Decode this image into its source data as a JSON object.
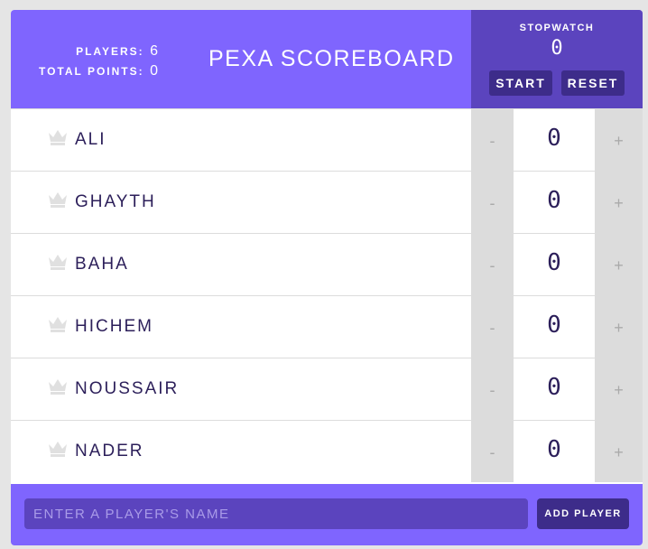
{
  "header": {
    "players_label": "PLAYERS:",
    "players_count": "6",
    "total_points_label": "TOTAL POINTS:",
    "total_points": "0",
    "title": "PEXA SCOREBOARD"
  },
  "stopwatch": {
    "label": "STOPWATCH",
    "time": "0",
    "start_label": "START",
    "reset_label": "RESET"
  },
  "players": [
    {
      "name": "ALI",
      "score": "0",
      "decrement_label": "-",
      "increment_label": "+",
      "crown_icon": "crown-icon"
    },
    {
      "name": "GHAYTH",
      "score": "0",
      "decrement_label": "-",
      "increment_label": "+",
      "crown_icon": "crown-icon"
    },
    {
      "name": "BAHA",
      "score": "0",
      "decrement_label": "-",
      "increment_label": "+",
      "crown_icon": "crown-icon"
    },
    {
      "name": "HICHEM",
      "score": "0",
      "decrement_label": "-",
      "increment_label": "+",
      "crown_icon": "crown-icon"
    },
    {
      "name": "NOUSSAIR",
      "score": "0",
      "decrement_label": "-",
      "increment_label": "+",
      "crown_icon": "crown-icon"
    },
    {
      "name": "NADER",
      "score": "0",
      "decrement_label": "-",
      "increment_label": "+",
      "crown_icon": "crown-icon"
    }
  ],
  "footer": {
    "input_placeholder": "ENTER A PLAYER'S NAME",
    "input_value": "",
    "add_button_label": "ADD PLAYER"
  },
  "colors": {
    "primary": "#7f65fe",
    "dark": "#5b44be",
    "button": "#3d2c8a",
    "control_bg": "#dcdcdc",
    "text_dark": "#2c1f5a",
    "crown_inactive": "#e0e0e0"
  }
}
